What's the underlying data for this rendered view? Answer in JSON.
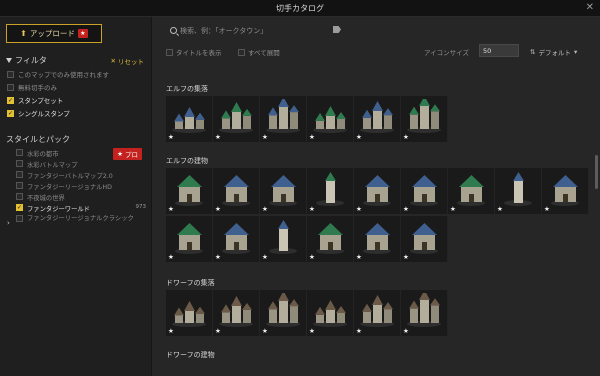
{
  "window": {
    "title": "切手カタログ",
    "close_glyph": "✕"
  },
  "sidebar": {
    "upload_label": "アップロード",
    "filter_title": "フィルタ",
    "reset_label": "リセット",
    "filters": [
      {
        "label": "このマップでのみ使用されます",
        "checked": false
      },
      {
        "label": "無料切手のみ",
        "checked": false
      },
      {
        "label": "スタンプセット",
        "checked": true
      },
      {
        "label": "シングルスタンプ",
        "checked": true
      }
    ],
    "style_title": "スタイルとパック",
    "pro_label": "プロ",
    "styles": [
      {
        "label": "水彩の都市",
        "checked": false
      },
      {
        "label": "水彩バトルマップ",
        "checked": false
      },
      {
        "label": "ファンタジーバトルマップ2.0",
        "checked": false
      },
      {
        "label": "ファンタジーリージョナルHD",
        "checked": false
      },
      {
        "label": "不夜城の世界",
        "checked": false
      },
      {
        "label": "ファンタジーワールド",
        "checked": true,
        "count": "973"
      },
      {
        "label": "ファンタジーリージョナルクラシック",
        "checked": false
      }
    ]
  },
  "toolbar": {
    "search_placeholder": "検索、例：「オークタウン」",
    "show_titles_label": "タイトルを表示",
    "expand_all_label": "すべて展開",
    "icon_size_label": "アイコンサイズ",
    "icon_size_value": "50",
    "sort_label": "デフォルト"
  },
  "groups": [
    {
      "title": "エルフの集落",
      "count": 6
    },
    {
      "title": "エルフの建物",
      "count": 15
    },
    {
      "title": "ドワーフの集落",
      "count": 6
    },
    {
      "title": "ドワーフの建物",
      "count": 0
    }
  ],
  "colors": {
    "accent_gold": "#e2c032",
    "pro_red": "#c4221f",
    "elf_green": "#2f7a4f",
    "elf_blue": "#3f5f8f",
    "dwarf_stone": "#8a7a66"
  },
  "icons": {
    "star": "★",
    "upload": "⬆",
    "funnel": "filter-icon",
    "reset": "x-icon",
    "sort": "sort-icon",
    "chevron": "›"
  }
}
